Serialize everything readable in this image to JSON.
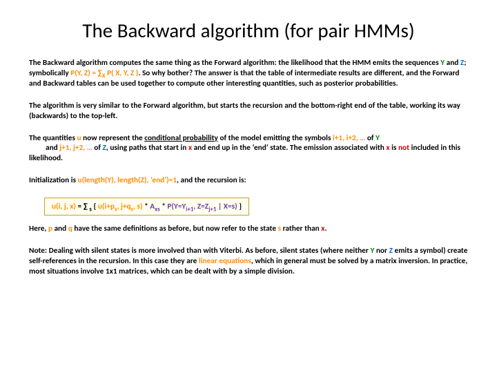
{
  "title": "The Backward algorithm (for pair HMMs)",
  "p1": {
    "lead": "The Backward algorithm computes the same thing as the Forward algorithm: the likelihood that the HMM emits the sequences ",
    "Y": "Y",
    "and": " and ",
    "Z": "Z",
    "sym1": "; symbolically ",
    "pyz": "P(Y, Z) = ∑",
    "subX": "X",
    "pxyz": " P( X, Y, Z )",
    "tail": ". So why bother? The answer is that the table of intermediate results are different, and the Forward and Backward tables can be used together to compute other interesting quantities, such as posterior probabilities."
  },
  "p2": "The algorithm is very similar to the Forward algorithm, but starts the recursion and the bottom-right end of the table, working its way (backwards) to the top-left.",
  "p3": {
    "a": "The quantities ",
    "u": "u",
    "b": " now represent the ",
    "cp": "conditional probability",
    "c": " of the model emitting the symbols ",
    "idx": "i+1, i+2, …",
    "d": " of ",
    "Y": "Y",
    "e": " and ",
    "jdx": "j+1, j+2, …",
    "f": " of ",
    "Z": "Z",
    "g": ", using paths that start in ",
    "x": "x",
    "h": " and end up in the ‘end’ state. The emission associated with ",
    "x2": "x",
    "i": " is ",
    "not": "not",
    "j": " included in this likelihood."
  },
  "p4": {
    "a": "Initialization is ",
    "init": "u(length(Y), length(Z), ‘end’)=1",
    "b": ", and the recursion is:"
  },
  "formula": {
    "lhs_u": "u(i, j, x)",
    "eq": " = ∑ ",
    "sub_s": "s",
    "open": " { ",
    "u2a": "u(i+p",
    "u2s1": "s",
    "u2b": ", j+q",
    "u2s2": "s",
    "u2c": ", s)",
    "star1": " * ",
    "AxsA": "A",
    "Axs_sub": "xs",
    "star2": " * ",
    "Pa": "P(Y=Y",
    "Pis": "i+1",
    "Pb": ", Z=Z",
    "Pjs": "j+1",
    "Pc": " | X=s)",
    "close": " }"
  },
  "p5": {
    "a": "Here, ",
    "p": "p",
    "b": " and ",
    "q": "q",
    "c": " have the same definitions as before, but now refer to the state ",
    "s": "s",
    "d": " rather than ",
    "x": "x",
    "e": "."
  },
  "p6": {
    "a": "Note: Dealing with silent states is more involved than with Viterbi. As before, silent states (where neither ",
    "Y": "Y",
    "b": " nor ",
    "Z": "Z",
    "c": " emits a symbol) create self-references in the recursion. In this case they are ",
    "lin": "linear equations",
    "d": ", which in general must be solved by a matrix inversion. In practice, most situations involve 1x1 matrices, which can be dealt with by a simple division."
  }
}
